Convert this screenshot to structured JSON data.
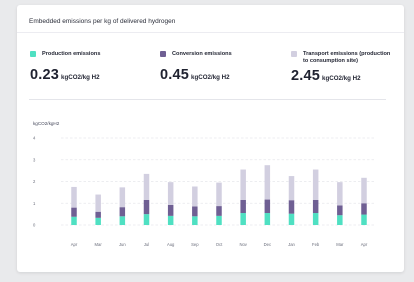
{
  "card": {
    "title": "Embedded emissions per kg of delivered hydrogen"
  },
  "metrics": [
    {
      "label": "Production emissions",
      "value": "0.23",
      "unit": "kgCO2/kg H2",
      "color": "#4fe0c2"
    },
    {
      "label": "Conversion emissions",
      "value": "0.45",
      "unit": "kgCO2/kg H2",
      "color": "#6f5f93"
    },
    {
      "label": "Transport emissions (production to consumption site)",
      "value": "2.45",
      "unit": "kgCO2/kg H2",
      "color": "#d2cfe0"
    }
  ],
  "chart_data": {
    "type": "bar",
    "stacked": true,
    "ylabel": "kgCO2/kgH2",
    "ylim": [
      0,
      4
    ],
    "yticks": [
      0,
      1,
      2,
      3,
      4
    ],
    "grid": "horizontal dashed",
    "categories": [
      "Apr",
      "Mar",
      "Jun",
      "Jul",
      "Aug",
      "Sep",
      "Oct",
      "Nov",
      "Dec",
      "Jan",
      "Feb",
      "Mar",
      "Apr"
    ],
    "series": [
      {
        "color": "#4fe0c2",
        "values": [
          0.38,
          0.33,
          0.4,
          0.5,
          0.42,
          0.4,
          0.42,
          0.55,
          0.55,
          0.52,
          0.55,
          0.45,
          0.48
        ]
      },
      {
        "color": "#6f5f93",
        "values": [
          0.42,
          0.28,
          0.42,
          0.65,
          0.5,
          0.45,
          0.45,
          0.6,
          0.62,
          0.62,
          0.6,
          0.45,
          0.52
        ]
      },
      {
        "color": "#d2cfe0",
        "values": [
          0.95,
          0.79,
          0.91,
          1.2,
          1.05,
          0.92,
          1.08,
          1.4,
          1.58,
          1.11,
          1.4,
          1.07,
          1.17
        ]
      }
    ]
  }
}
